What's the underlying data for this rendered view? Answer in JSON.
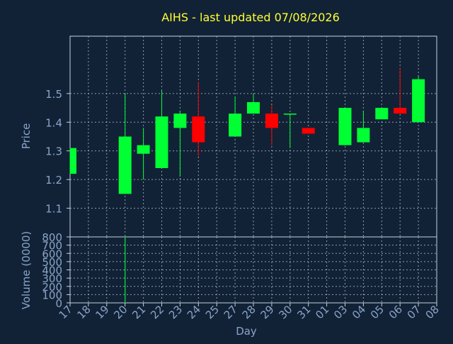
{
  "chart_data": {
    "type": "candlestick",
    "title": "AIHS - last updated 07/08/2026",
    "xlabel": "Day",
    "price_panel": {
      "ylabel": "Price",
      "yticks": [
        "1.1",
        "1.2",
        "1.3",
        "1.4",
        "1.5"
      ],
      "ylim": [
        1.0,
        1.7
      ]
    },
    "volume_panel": {
      "ylabel": "Volume (0000)",
      "yticks": [
        "0",
        "100",
        "200",
        "300",
        "400",
        "500",
        "600",
        "700",
        "800"
      ],
      "ylim": [
        0,
        800
      ]
    },
    "x_ticks": [
      "17",
      "18",
      "19",
      "20",
      "21",
      "22",
      "23",
      "24",
      "25",
      "27",
      "28",
      "29",
      "30",
      "31",
      "01",
      "03",
      "04",
      "05",
      "06",
      "07",
      "08"
    ],
    "grid": true,
    "colors": {
      "background": "#112236",
      "plot_border": "#c8d0dc",
      "grid": "#c8d0dc",
      "axis_text": "#8aa4c8",
      "title": "#ffff33",
      "up": "#00ff33",
      "down": "#ff0000",
      "volume_bar": "#00cc33"
    },
    "candles": [
      {
        "x": "17",
        "open": 1.22,
        "high": 1.31,
        "low": 1.22,
        "close": 1.31
      },
      {
        "x": "20",
        "open": 1.15,
        "high": 1.5,
        "low": 1.15,
        "close": 1.35
      },
      {
        "x": "21",
        "open": 1.29,
        "high": 1.38,
        "low": 1.2,
        "close": 1.32
      },
      {
        "x": "22",
        "open": 1.24,
        "high": 1.51,
        "low": 1.24,
        "close": 1.42
      },
      {
        "x": "23",
        "open": 1.38,
        "high": 1.44,
        "low": 1.21,
        "close": 1.43
      },
      {
        "x": "24",
        "open": 1.42,
        "high": 1.54,
        "low": 1.28,
        "close": 1.33
      },
      {
        "x": "27",
        "open": 1.35,
        "high": 1.49,
        "low": 1.35,
        "close": 1.43
      },
      {
        "x": "28",
        "open": 1.43,
        "high": 1.5,
        "low": 1.43,
        "close": 1.47
      },
      {
        "x": "29",
        "open": 1.43,
        "high": 1.46,
        "low": 1.32,
        "close": 1.38
      },
      {
        "x": "30",
        "open": 1.43,
        "high": 1.43,
        "low": 1.31,
        "close": 1.43
      },
      {
        "x": "31",
        "open": 1.38,
        "high": 1.38,
        "low": 1.36,
        "close": 1.36
      },
      {
        "x": "03",
        "open": 1.32,
        "high": 1.45,
        "low": 1.32,
        "close": 1.45
      },
      {
        "x": "04",
        "open": 1.33,
        "high": 1.44,
        "low": 1.33,
        "close": 1.38
      },
      {
        "x": "05",
        "open": 1.41,
        "high": 1.45,
        "low": 1.41,
        "close": 1.45
      },
      {
        "x": "06",
        "open": 1.45,
        "high": 1.59,
        "low": 1.43,
        "close": 1.43
      },
      {
        "x": "07",
        "open": 1.4,
        "high": 1.56,
        "low": 1.4,
        "close": 1.55
      }
    ],
    "volume": [
      {
        "x": "20",
        "value": 800
      }
    ]
  }
}
